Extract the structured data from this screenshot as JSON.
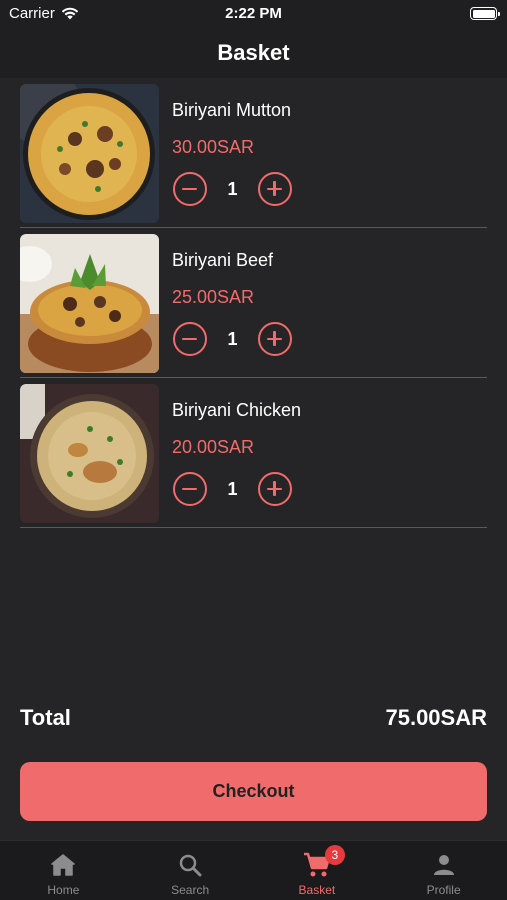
{
  "status_bar": {
    "carrier": "Carrier",
    "time": "2:22 PM"
  },
  "header": {
    "title": "Basket"
  },
  "basket": {
    "items": [
      {
        "name": "Biriyani Mutton",
        "price": "30.00SAR",
        "quantity": "1"
      },
      {
        "name": "Biriyani Beef",
        "price": "25.00SAR",
        "quantity": "1"
      },
      {
        "name": "Biriyani Chicken",
        "price": "20.00SAR",
        "quantity": "1"
      }
    ],
    "total_label": "Total",
    "total_value": "75.00SAR",
    "checkout_label": "Checkout"
  },
  "tab_bar": {
    "tabs": [
      {
        "label": "Home",
        "icon": "home-icon",
        "active": false
      },
      {
        "label": "Search",
        "icon": "search-icon",
        "active": false
      },
      {
        "label": "Basket",
        "icon": "cart-icon",
        "active": true,
        "badge": "3"
      },
      {
        "label": "Profile",
        "icon": "person-icon",
        "active": false
      }
    ]
  },
  "colors": {
    "accent": "#f26b6b",
    "checkout_button": "#f06c6c",
    "badge": "#e8393d",
    "background": "#252527",
    "inactive_tab": "#8c8c8e"
  }
}
